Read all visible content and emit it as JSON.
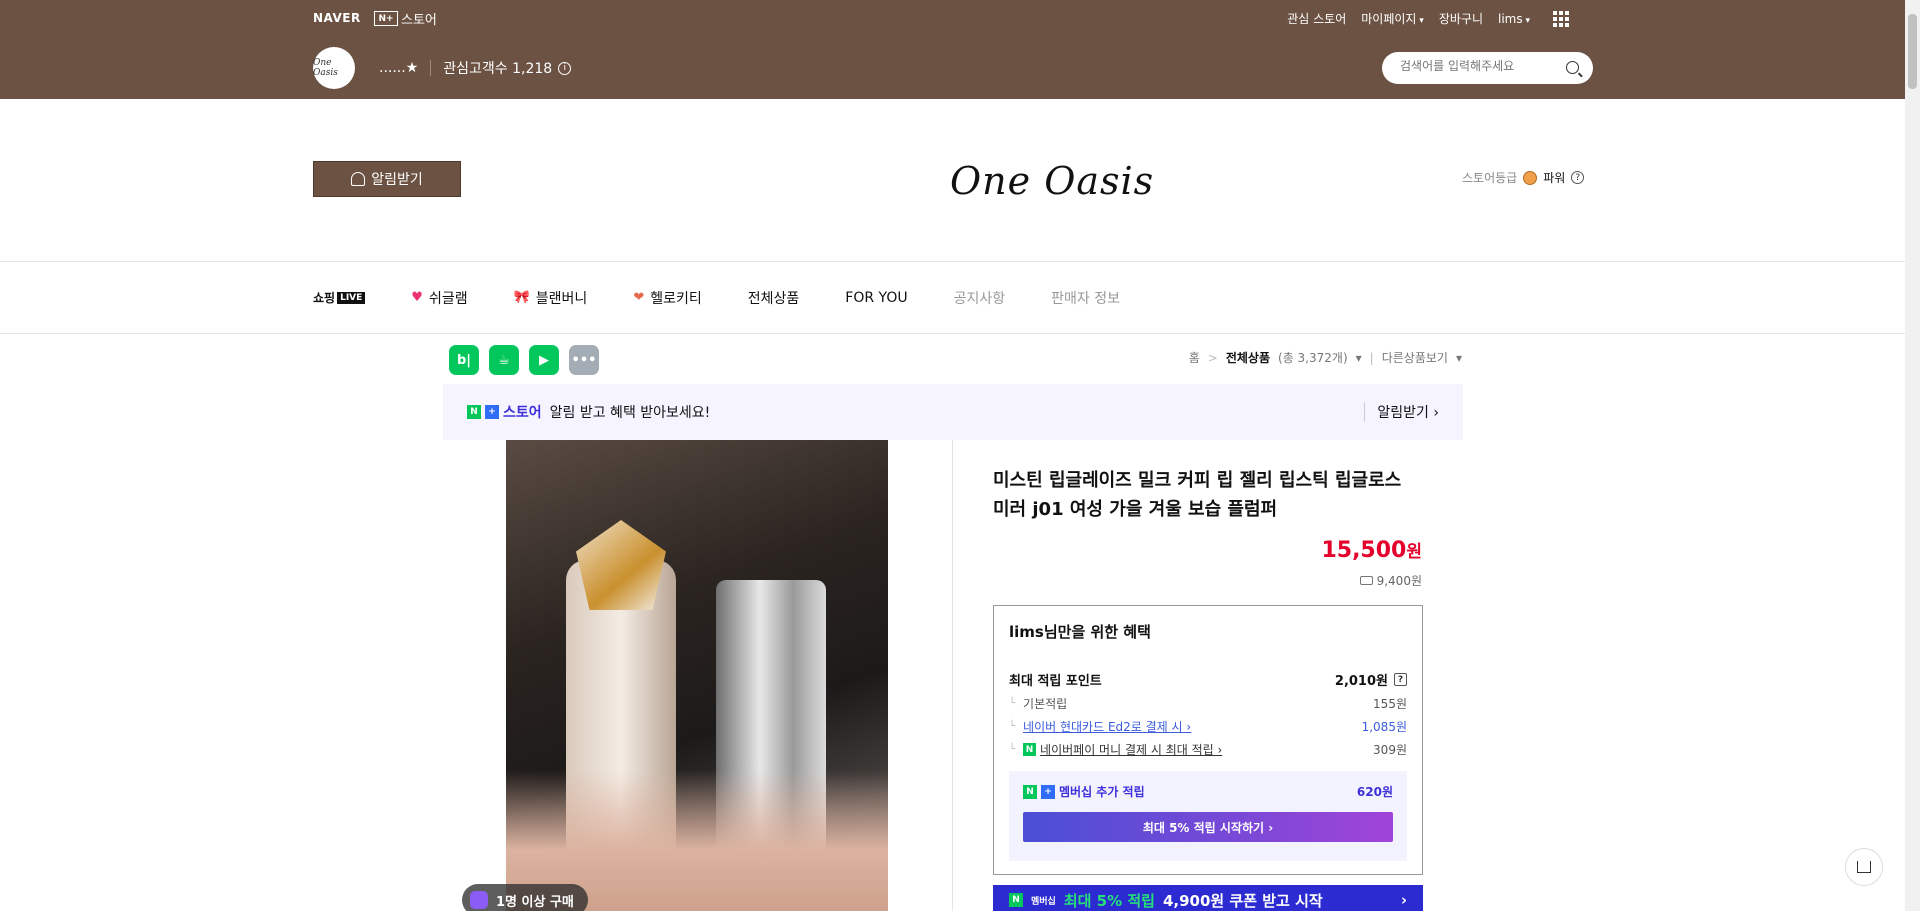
{
  "topbar": {
    "naver": "NAVER",
    "nplus_store": "스토어",
    "nplus_badge": "N+",
    "links": [
      "관심 스토어",
      "마이페이지",
      "장바구니",
      "lims"
    ],
    "store_avatar_text": "One Oasis",
    "store_name": "......★",
    "followers_label": "관심고객수 1,218",
    "search_placeholder": "검색어를 입력해주세요"
  },
  "brand": {
    "notify_label": "알림받기",
    "logo_text": "One Oasis",
    "grade_label": "스토어등급",
    "grade_value": "파워"
  },
  "categories": [
    {
      "label": "쇼핑",
      "badge": "LIVE"
    },
    {
      "label": "쉬글램",
      "icon": "heart-icon"
    },
    {
      "label": "블랜버니",
      "icon": "ribbon-icon"
    },
    {
      "label": "헬로키티",
      "icon": "kitty-icon"
    },
    {
      "label": "전체상품"
    },
    {
      "label": "FOR YOU"
    },
    {
      "label": "공지사항"
    },
    {
      "label": "판매자 정보"
    }
  ],
  "socials": [
    "b|",
    "☕",
    "▶",
    "•••"
  ],
  "breadcrumb": {
    "home": "홈",
    "current": "전체상품",
    "count": "(총 3,372개)",
    "other": "다른상품보기"
  },
  "promo": {
    "store": "스토어",
    "text": "알림 받고 혜택 받아보세요!",
    "link": "알림받기 ›"
  },
  "product": {
    "buyers_badge": "1명 이상 구매",
    "title": "미스틴 립글레이즈 밀크 커피 립 젤리 립스틱 립글로스 미러 j01 여성 가을 겨울 보습 플럼퍼",
    "price": "15,500",
    "price_unit": "원",
    "shipping": "9,400원"
  },
  "benefit": {
    "head": "lims님만을 위한 혜택",
    "max_point_label": "최대 적립 포인트",
    "max_point_value": "2,010원",
    "rows": [
      {
        "label": "기본적립",
        "value": "155원"
      },
      {
        "label": "네이버 현대카드 Ed2로 결제 시 ›",
        "value": "1,085원"
      },
      {
        "label": "네이버페이 머니 결제 시 최대 적립 ›",
        "value": "309원"
      }
    ],
    "membership_label": "멤버십 추가 적립",
    "membership_value": "620원",
    "membership_button": "최대 5% 적립 시작하기 ›"
  },
  "coupon": {
    "badge": "멤버십",
    "highlight": "최대 5% 적립",
    "text": "4,900원 쿠폰 받고 시작",
    "arrow": "›"
  }
}
